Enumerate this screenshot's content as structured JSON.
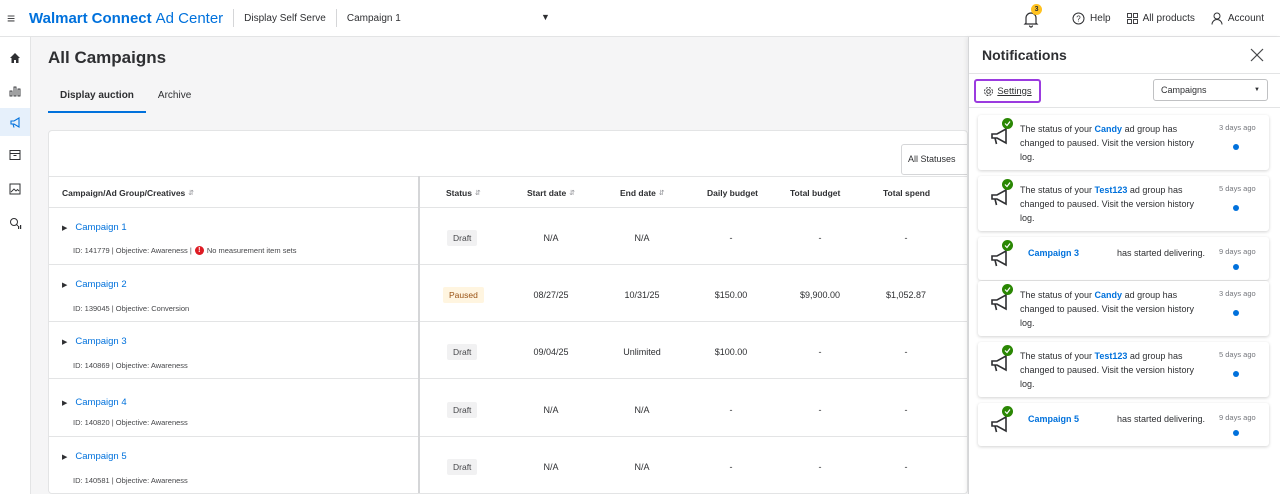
{
  "header": {
    "brand_walmart": "Walmart",
    "brand_connect": "Connect",
    "brand_adcenter": "Ad Center",
    "product": "Display Self Serve",
    "campaign_selector": "Campaign 1",
    "notif_count": "3",
    "help": "Help",
    "all_products": "All products",
    "account": "Account"
  },
  "page": {
    "title": "All Campaigns",
    "tabs": [
      "Display auction",
      "Archive"
    ],
    "status_filter": "All Statuses"
  },
  "table": {
    "headers": [
      "Campaign/Ad Group/Creatives",
      "Status",
      "Start date",
      "End date",
      "Daily budget",
      "Total budget",
      "Total spend"
    ],
    "rows": [
      {
        "name": "Campaign 1",
        "meta": "ID: 141779 | Objective: Awareness |",
        "warning": "No measurement item sets",
        "status": "Draft",
        "start": "N/A",
        "end": "N/A",
        "daily": "-",
        "total": "-",
        "spend": "-"
      },
      {
        "name": "Campaign 2",
        "meta": "ID: 139045 | Objective: Conversion",
        "warning": "",
        "status": "Paused",
        "start": "08/27/25",
        "end": "10/31/25",
        "daily": "$150.00",
        "total": "$9,900.00",
        "spend": "$1,052.87"
      },
      {
        "name": "Campaign 3",
        "meta": "ID: 140869 | Objective: Awareness",
        "warning": "",
        "status": "Draft",
        "start": "09/04/25",
        "end": "Unlimited",
        "daily": "$100.00",
        "total": "-",
        "spend": "-"
      },
      {
        "name": "Campaign 4",
        "meta": "ID: 140820 | Objective: Awareness",
        "warning": "",
        "status": "Draft",
        "start": "N/A",
        "end": "N/A",
        "daily": "-",
        "total": "-",
        "spend": "-"
      },
      {
        "name": "Campaign 5",
        "meta": "ID: 140581 | Objective: Awareness",
        "warning": "",
        "status": "Draft",
        "start": "N/A",
        "end": "N/A",
        "daily": "-",
        "total": "-",
        "spend": "-"
      }
    ]
  },
  "notifications": {
    "title": "Notifications",
    "settings_label": "Settings",
    "filter": "Campaigns",
    "items": [
      {
        "pre": "The status of your ",
        "bold": "Candy",
        "post": " ad group has changed to paused. Visit the version history log.",
        "time": "3 days ago"
      },
      {
        "pre": "The status of your ",
        "bold": "Test123",
        "post": " ad group has changed to paused. Visit the version history log.",
        "time": "5 days ago"
      },
      {
        "pre": "",
        "bold": "Campaign 3",
        "post": "has started delivering.",
        "time": "9 days ago"
      },
      {
        "pre": "The status of your ",
        "bold": "Candy",
        "post": " ad group has changed to paused. Visit the version history log.",
        "time": "3 days ago"
      },
      {
        "pre": "The status of your ",
        "bold": "Test123",
        "post": " ad group has changed to paused. Visit the version history log.",
        "time": "5 days ago"
      },
      {
        "pre": "",
        "bold": "Campaign 5",
        "post": "has started delivering.",
        "time": "9 days ago"
      }
    ]
  },
  "colors": {
    "accent": "#0071dc",
    "focus": "#9b3bdf",
    "success": "#2a8703",
    "badge": "#ffc220"
  }
}
